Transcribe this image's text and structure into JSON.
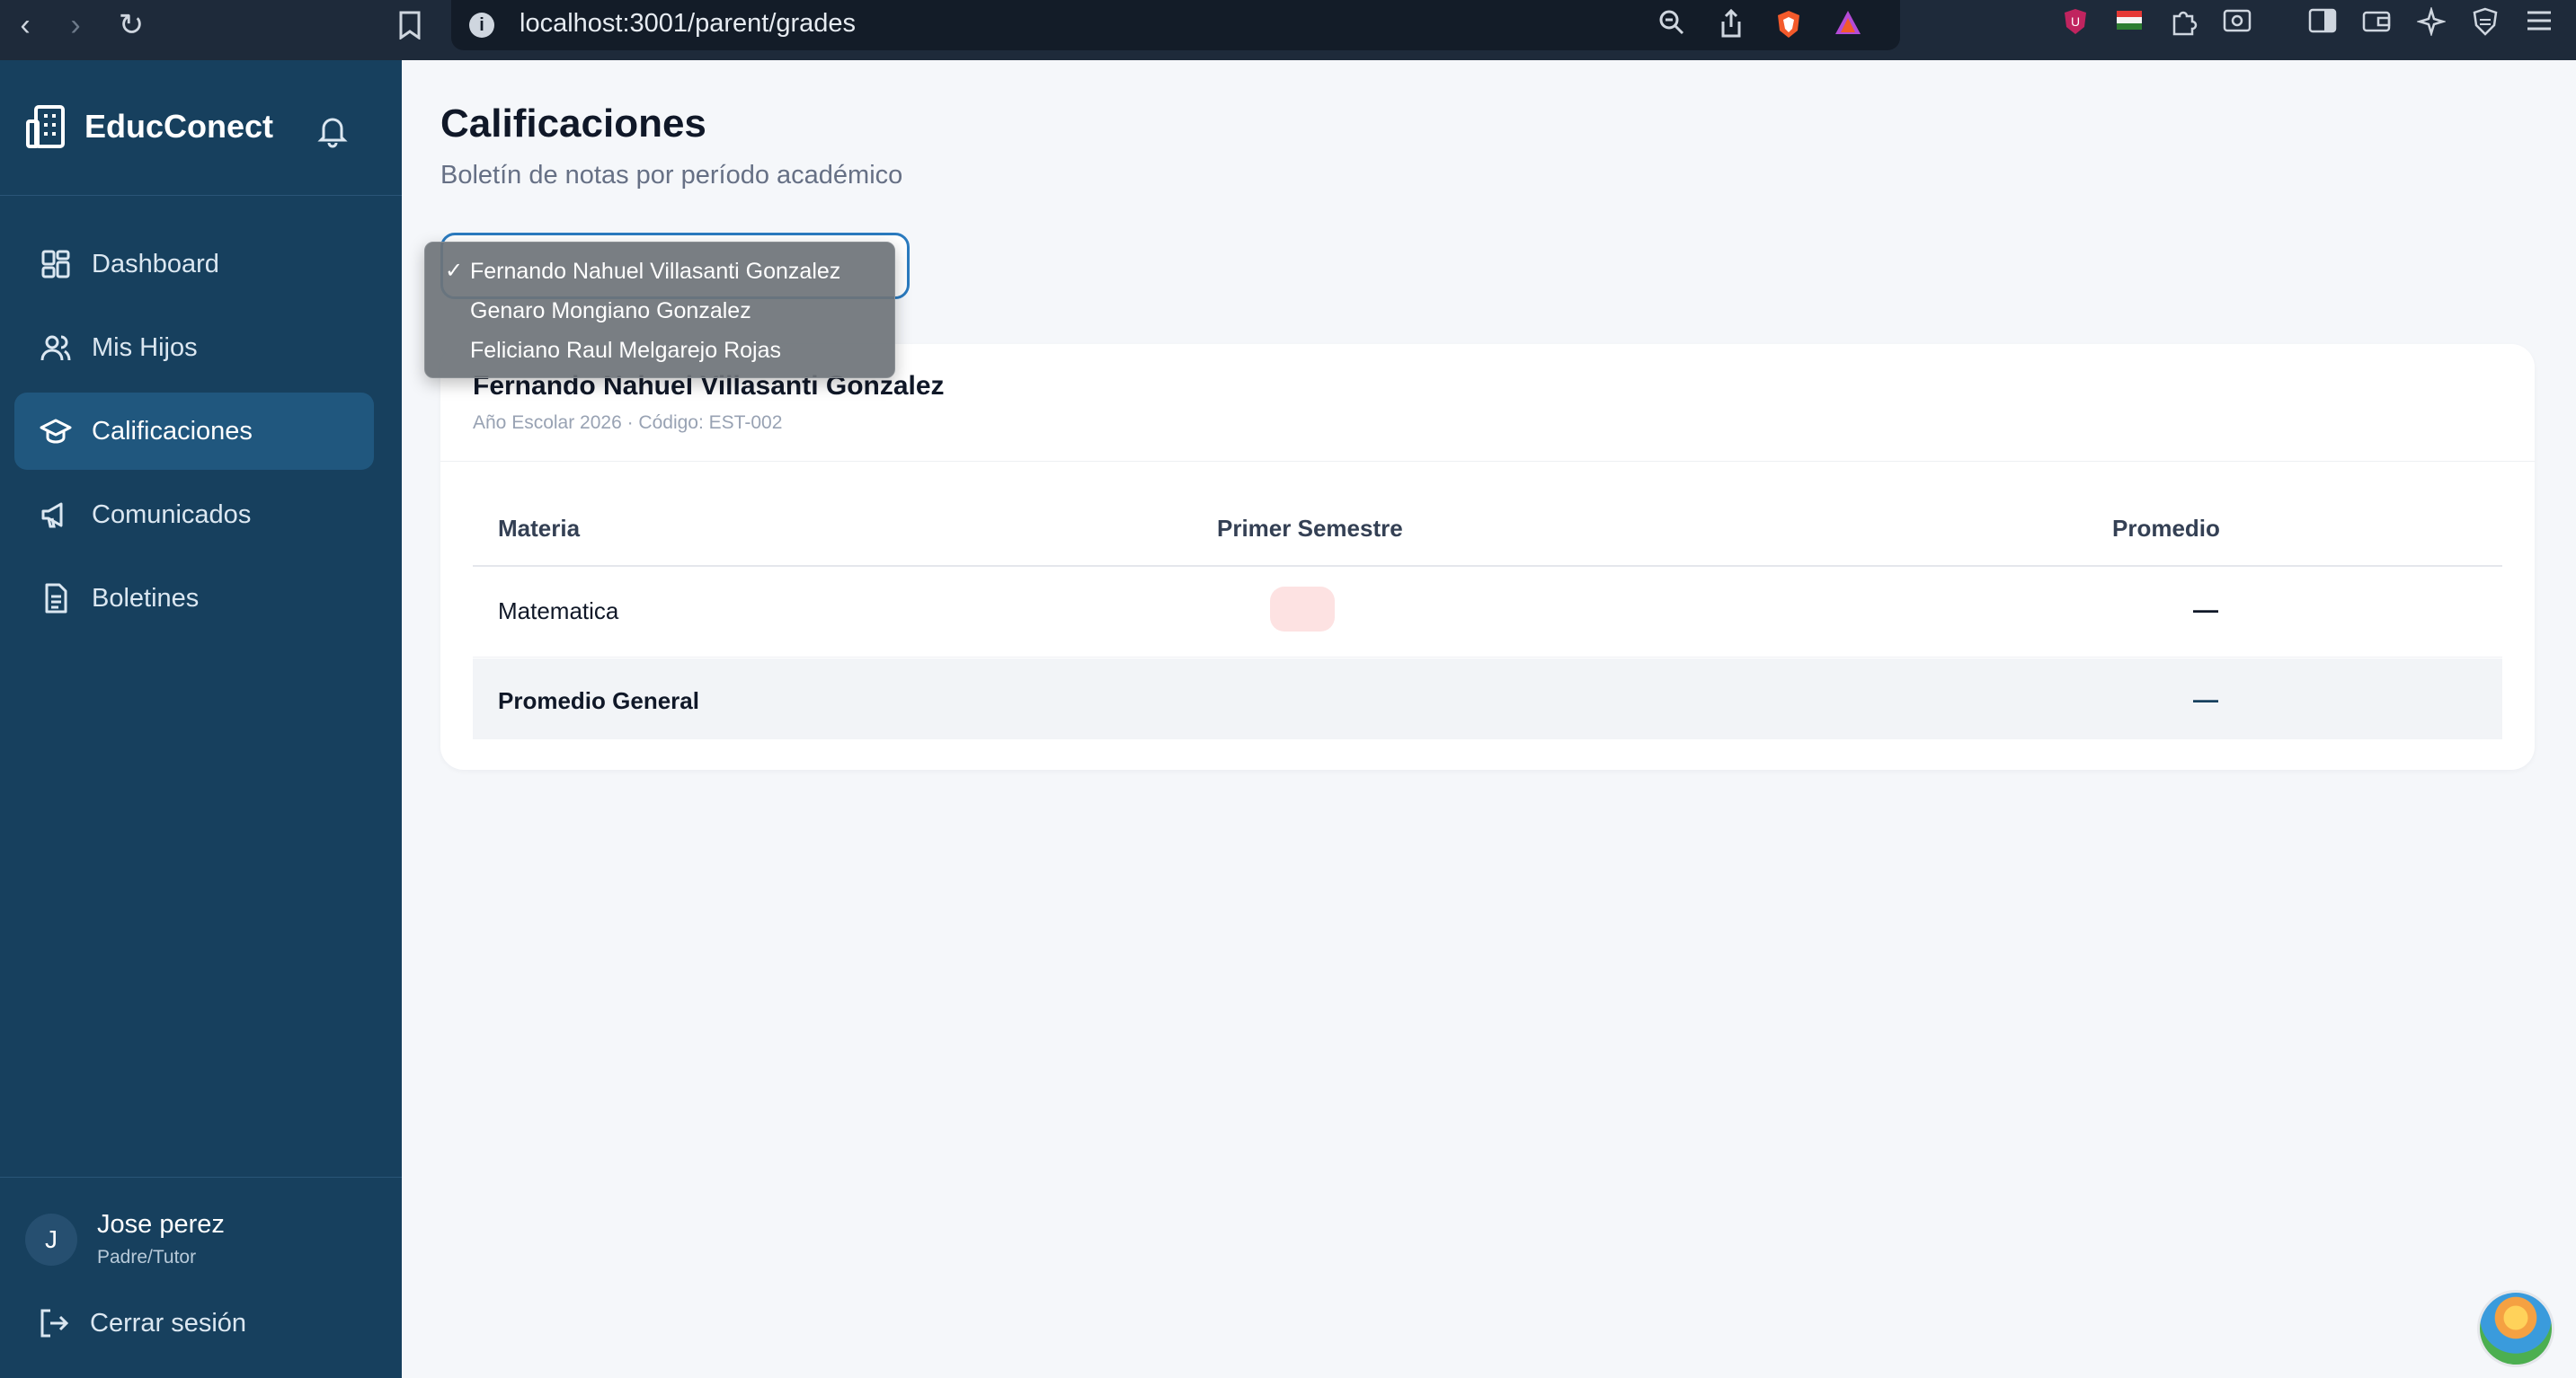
{
  "browser": {
    "url": "localhost:3001/parent/grades"
  },
  "sidebar": {
    "brand": "EducConect",
    "items": [
      {
        "label": "Dashboard"
      },
      {
        "label": "Mis Hijos"
      },
      {
        "label": "Calificaciones"
      },
      {
        "label": "Comunicados"
      },
      {
        "label": "Boletines"
      }
    ],
    "user": {
      "initial": "J",
      "name": "Jose perez",
      "role": "Padre/Tutor"
    },
    "logout_label": "Cerrar sesión"
  },
  "main": {
    "title": "Calificaciones",
    "subtitle": "Boletín de notas por período académico",
    "student_select": {
      "options": [
        "Fernando Nahuel Villasanti Gonzalez",
        "Genaro Mongiano Gonzalez",
        "Feliciano Raul Melgarejo Rojas"
      ],
      "selected_index": 0
    },
    "card": {
      "student_name": "Fernando Nahuel Villasanti Gonzalez",
      "meta": "Año Escolar 2026 · Código: EST-002",
      "columns": [
        "Materia",
        "Primer Semestre",
        "Promedio"
      ],
      "rows": [
        {
          "subject": "Matematica",
          "average": "—"
        }
      ],
      "summary_label": "Promedio General",
      "summary_value": "—"
    }
  },
  "colors": {
    "sidebar_bg": "#17405e",
    "active_item_bg": "#20577e",
    "accent": "#2b7bbf"
  }
}
